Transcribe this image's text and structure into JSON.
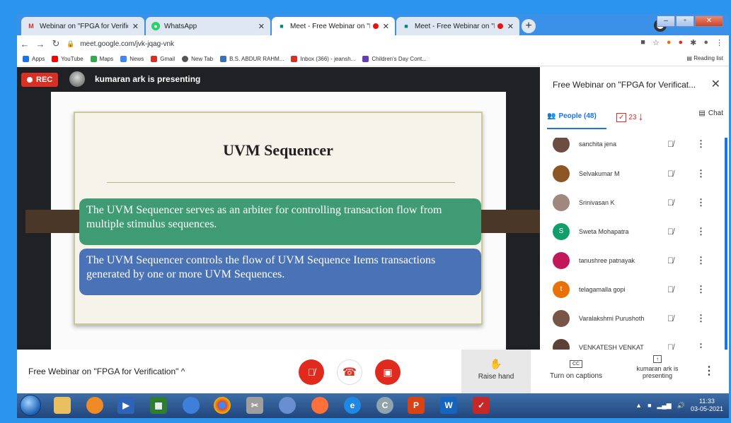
{
  "tabs": [
    {
      "title": "Webinar on \"FPGA for Verificatio",
      "icon": "gmail-icon",
      "state": "inactive"
    },
    {
      "title": "WhatsApp",
      "icon": "whatsapp-icon",
      "state": "inactive"
    },
    {
      "title": "Meet - Free Webinar on \"FP",
      "icon": "meet-icon",
      "state": "active"
    },
    {
      "title": "Meet - Free Webinar on \"FP",
      "icon": "meet-icon",
      "state": "inactive"
    }
  ],
  "address": {
    "url": "meet.google.com/jvk-jqag-vnk"
  },
  "bookmarks": [
    {
      "label": "Apps",
      "color": "#1a73e8"
    },
    {
      "label": "YouTube",
      "color": "#ff0000"
    },
    {
      "label": "Maps",
      "color": "#34a853"
    },
    {
      "label": "News",
      "color": "#4285f4"
    },
    {
      "label": "Gmail",
      "color": "#d93025"
    },
    {
      "label": "New Tab",
      "color": "#555555"
    },
    {
      "label": "B.S. ABDUR RAHM...",
      "color": "#3b6fb6"
    },
    {
      "label": "Inbox (366) - jeansh...",
      "color": "#d93025"
    },
    {
      "label": "Children's Day Cont...",
      "color": "#673ab7"
    }
  ],
  "reading_list": "Reading list",
  "stage": {
    "rec_label": "REC",
    "presenting_text": "kumaran ark is presenting"
  },
  "slide": {
    "title": "UVM Sequencer",
    "box1": "The UVM Sequencer serves as an arbiter for controlling transaction flow from multiple stimulus sequences.",
    "box2": "The UVM Sequencer controls the flow of UVM Sequence Items transactions generated by one or more UVM Sequences."
  },
  "sidebar": {
    "title": "Free Webinar on \"FPGA for Verificat...",
    "people_tab": "People (48)",
    "hand_count": "23",
    "chat_tab": "Chat",
    "participants": [
      {
        "name": "sanchita jena",
        "avatar_color": "#6d4c41",
        "initial": ""
      },
      {
        "name": "Selvakumar M",
        "avatar_color": "#8d5524",
        "initial": ""
      },
      {
        "name": "Srinivasan K",
        "avatar_color": "#a1887f",
        "initial": ""
      },
      {
        "name": "Sweta Mohapatra",
        "avatar_color": "#129e6b",
        "initial": "S"
      },
      {
        "name": "tanushree patnayak",
        "avatar_color": "#c2185b",
        "initial": ""
      },
      {
        "name": "telagamalla gopi",
        "avatar_color": "#e8710a",
        "initial": "t"
      },
      {
        "name": "Varalakshmi Purushoth",
        "avatar_color": "#795548",
        "initial": ""
      },
      {
        "name": "VENKATESH VENKAT",
        "avatar_color": "#5d4037",
        "initial": ""
      }
    ]
  },
  "bottom": {
    "meeting_name": "Free Webinar on \"FPGA for Verification\"",
    "raise_hand": "Raise hand",
    "captions": "Turn on captions",
    "presenting": "kumaran ark is presenting"
  },
  "taskbar": {
    "time": "11:33",
    "date": "03-05-2021"
  }
}
